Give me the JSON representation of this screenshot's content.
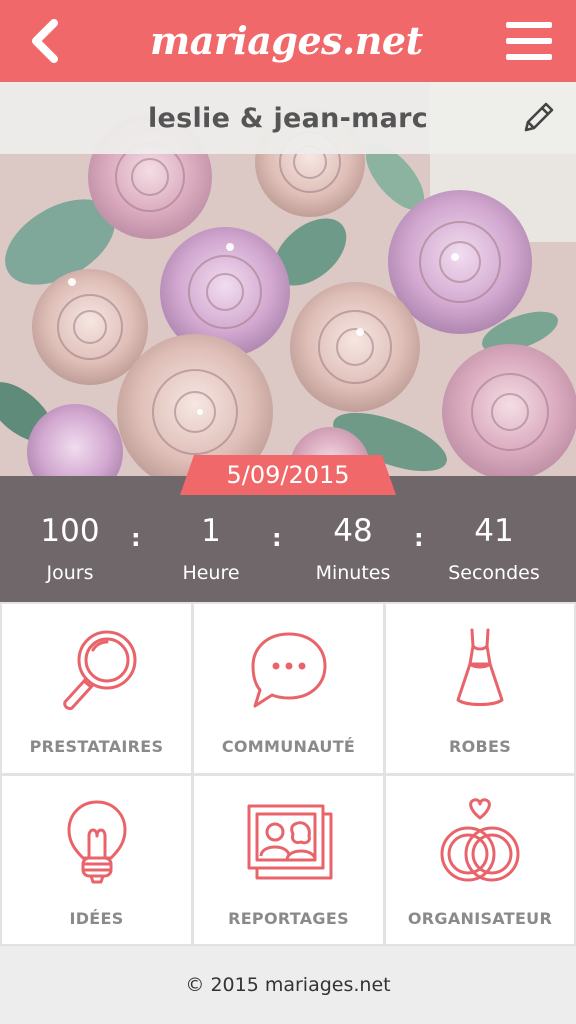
{
  "header": {
    "brand": "mariages.net",
    "back_icon": "chevron-left-icon",
    "menu_icon": "hamburger-menu-icon",
    "color": "#f0686a"
  },
  "couple": {
    "names": "leslie & jean-marc",
    "edit_icon": "pencil-icon"
  },
  "wedding": {
    "date": "5/09/2015"
  },
  "countdown": {
    "separator": ":",
    "units": [
      {
        "value": "100",
        "label": "Jours"
      },
      {
        "value": "1",
        "label": "Heure"
      },
      {
        "value": "48",
        "label": "Minutes"
      },
      {
        "value": "41",
        "label": "Secondes"
      }
    ]
  },
  "menu": {
    "items": [
      {
        "label": "PRESTATAIRES",
        "icon": "magnifier-icon"
      },
      {
        "label": "COMMUNAUTÉ",
        "icon": "chat-bubble-icon"
      },
      {
        "label": "ROBES",
        "icon": "dress-icon"
      },
      {
        "label": "IDÉES",
        "icon": "lightbulb-icon"
      },
      {
        "label": "REPORTAGES",
        "icon": "photo-album-icon"
      },
      {
        "label": "ORGANISATEUR",
        "icon": "wedding-rings-icon"
      }
    ],
    "icon_color": "#e9646a"
  },
  "footer": {
    "copyright": "© 2015 mariages.net"
  }
}
